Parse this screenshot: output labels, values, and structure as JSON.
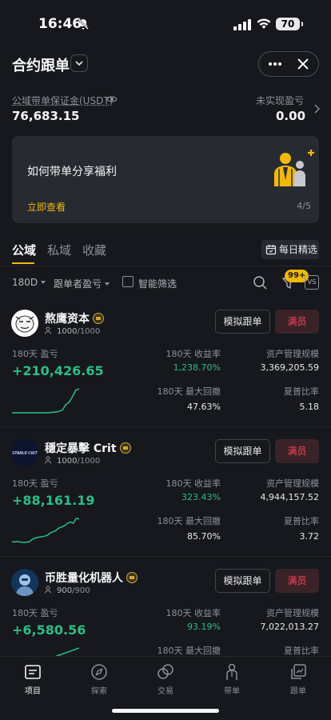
{
  "status_bar": {
    "time": "16:46",
    "battery": "70"
  },
  "header": {
    "title": "合约跟单"
  },
  "account": {
    "margin_label": "公域带单保证金(USDT)",
    "margin_value": "76,683.15",
    "upl_label": "未实现盈亏",
    "upl_value": "0.00"
  },
  "banner": {
    "title": "如何带单分享福利",
    "link": "立即查看",
    "page": "4/5"
  },
  "tabs": [
    {
      "label": "公域",
      "active": true
    },
    {
      "label": "私域",
      "active": false
    },
    {
      "label": "收藏",
      "active": false
    }
  ],
  "daily_pick": "每日精选",
  "filters": {
    "period": "180D",
    "sort": "跟单者盈亏",
    "smart_filter": "智能筛选",
    "badge_count": "99+",
    "vs_label": "VS"
  },
  "traders": [
    {
      "name": "熬鹰资本",
      "followers": "1000",
      "max_followers": "/1000",
      "sim_label": "模拟跟单",
      "full_label": "满员",
      "pnl_label": "180天 盈亏",
      "pnl": "+210,426.65",
      "roi_label": "180天  收益率",
      "roi": "1,238.70%",
      "aum_label": "资产管理规模",
      "aum": "3,369,205.59",
      "mdd_label": "180天  最大回撤",
      "mdd": "47.63%",
      "sharpe_label": "夏普比率",
      "sharpe": "5.18",
      "spark": [
        1,
        1,
        1,
        1,
        1,
        1,
        1,
        1,
        1,
        1,
        1,
        1,
        1.2,
        1.3,
        1.5,
        2,
        4,
        5,
        7,
        9.5,
        10
      ]
    },
    {
      "name": "穩定暴擊 Crit",
      "followers": "1000",
      "max_followers": "/1000",
      "sim_label": "模拟跟单",
      "full_label": "满员",
      "pnl_label": "180天 盈亏",
      "pnl": "+88,161.19",
      "roi_label": "180天  收益率",
      "roi": "323.43%",
      "aum_label": "资产管理规模",
      "aum": "4,944,157.52",
      "mdd_label": "180天  最大回撤",
      "mdd": "85.70%",
      "sharpe_label": "夏普比率",
      "sharpe": "3.72",
      "spark": [
        0.5,
        0.4,
        0.6,
        0.3,
        0.2,
        0.3,
        0.5,
        1.5,
        2,
        2.3,
        2.5,
        2.7,
        3,
        4,
        4.5,
        5,
        6,
        6.5,
        7,
        8,
        8.5,
        8,
        10,
        9.8
      ]
    },
    {
      "name": "币胜量化机器人",
      "followers": "900",
      "max_followers": "/900",
      "sim_label": "模拟跟单",
      "full_label": "满员",
      "pnl_label": "180天 盈亏",
      "pnl": "+6,580.56",
      "roi_label": "180天  收益率",
      "roi": "93.19%",
      "aum_label": "资产管理规模",
      "aum": "7,022,013.27",
      "mdd_label": "180天  最大回撤",
      "mdd": "",
      "sharpe_label": "夏普比率",
      "sharpe": "",
      "spark": [
        1,
        2,
        3,
        4,
        5
      ]
    }
  ],
  "tabbar": [
    {
      "label": "项目",
      "icon": "project-icon",
      "active": true
    },
    {
      "label": "探索",
      "icon": "compass-icon",
      "active": false
    },
    {
      "label": "交易",
      "icon": "trade-icon",
      "active": false
    },
    {
      "label": "带单",
      "icon": "lead-icon",
      "active": false
    },
    {
      "label": "跟单",
      "icon": "copy-icon",
      "active": false
    }
  ]
}
